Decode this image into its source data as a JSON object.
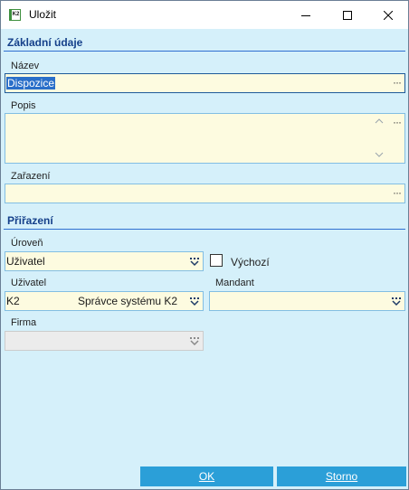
{
  "window": {
    "title": "Uložit",
    "icon_text": "K2"
  },
  "section_basic": {
    "title": "Základní údaje"
  },
  "nazev": {
    "label": "Název",
    "value": "Dispozice"
  },
  "popis": {
    "label": "Popis",
    "value": ""
  },
  "zarazeni": {
    "label": "Zařazení",
    "value": ""
  },
  "section_assign": {
    "title": "Přiřazení"
  },
  "uroven": {
    "label": "Úroveň",
    "value": "Uživatel"
  },
  "vychozi": {
    "label": "Výchozí",
    "checked": false
  },
  "uzivatel": {
    "label": "Uživatel",
    "code": "K2",
    "name": "Správce systému K2"
  },
  "mandant": {
    "label": "Mandant",
    "value": ""
  },
  "firma": {
    "label": "Firma",
    "value": ""
  },
  "buttons": {
    "ok": "OK",
    "storno": "Storno"
  },
  "colors": {
    "accent": "#2b9fd8",
    "background": "#d5f0fa",
    "field": "#fdfbe0",
    "section": "#15408a"
  }
}
